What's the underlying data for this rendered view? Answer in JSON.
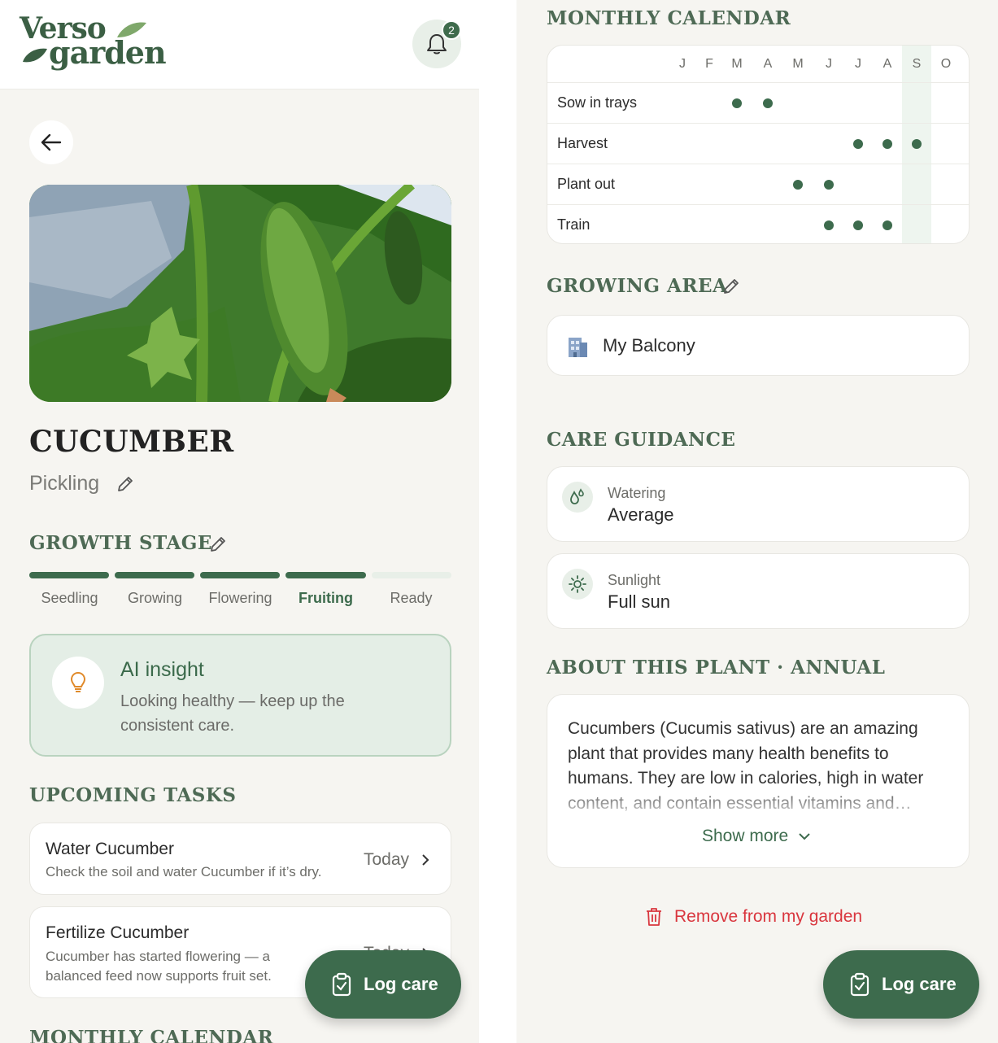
{
  "app": {
    "logo_line1": "Verso",
    "logo_line2": "garden",
    "notification_count": "2"
  },
  "plant": {
    "name": "CUCUMBER",
    "variety": "Pickling"
  },
  "growth_stage": {
    "title": "GROWTH STAGE",
    "stages": [
      "Seedling",
      "Growing",
      "Flowering",
      "Fruiting",
      "Ready"
    ],
    "current": "Fruiting"
  },
  "insight": {
    "title": "AI insight",
    "text": "Looking healthy — keep up the consistent care."
  },
  "tasks": {
    "title": "UPCOMING TASKS",
    "items": [
      {
        "title": "Water Cucumber",
        "desc": "Check the soil and water Cucumber if it’s dry.",
        "when": "Today"
      },
      {
        "title": "Fertilize Cucumber",
        "desc": "Cucumber has started flowering — a balanced feed now supports fruit set.",
        "when": "Today"
      }
    ]
  },
  "fab": {
    "label": "Log care"
  },
  "calendar": {
    "title": "MONTHLY CALENDAR",
    "months": [
      "J",
      "F",
      "M",
      "A",
      "M",
      "J",
      "J",
      "A",
      "S",
      "O"
    ],
    "current_month": "S",
    "rows": [
      {
        "label": "Sow in trays",
        "active": [
          "M",
          "A"
        ]
      },
      {
        "label": "Harvest",
        "active": [
          "J",
          "A",
          "S"
        ]
      },
      {
        "label": "Plant out",
        "active": [
          "M",
          "J"
        ]
      },
      {
        "label": "Train",
        "active": [
          "J",
          "J",
          "A"
        ]
      }
    ]
  },
  "growing_area": {
    "title": "GROWING AREA",
    "name": "My Balcony"
  },
  "care_guidance": {
    "title": "CARE GUIDANCE",
    "items": [
      {
        "label": "Watering",
        "value": "Average",
        "icon": "water-drops-icon"
      },
      {
        "label": "Sunlight",
        "value": "Full sun",
        "icon": "sun-icon"
      }
    ]
  },
  "about": {
    "title": "ABOUT THIS PLANT · ANNUAL",
    "text": "Cucumbers (Cucumis sativus) are an amazing plant that provides many health benefits to humans. They are low in calories, high in water content, and contain essential vitamins and…",
    "show_more": "Show more"
  },
  "remove_label": "Remove from my garden",
  "colors": {
    "brand": "#3d6b4d",
    "background": "#f6f5f1",
    "insight_bg": "#e4eee6",
    "danger": "#d9363e"
  }
}
